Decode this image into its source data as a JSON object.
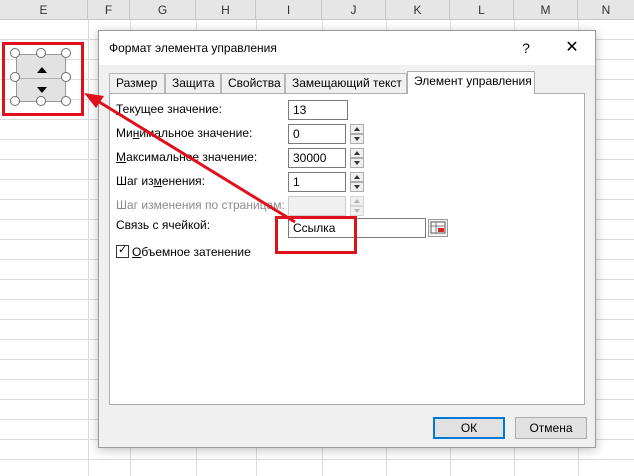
{
  "sheet": {
    "columns": [
      "E",
      "F",
      "G",
      "H",
      "I",
      "J",
      "K",
      "L",
      "M",
      "N"
    ]
  },
  "dialog": {
    "title": "Формат элемента управления",
    "help_glyph": "?",
    "close_glyph": "✕",
    "tabs": [
      {
        "label": "Размер"
      },
      {
        "label": "Защита"
      },
      {
        "label": "Свойства"
      },
      {
        "label": "Замещающий текст"
      },
      {
        "label": "Элемент управления",
        "active": true
      }
    ],
    "fields": {
      "current": {
        "label_pre": "",
        "label_u": "Т",
        "label_post": "екущее значение:",
        "value": "13"
      },
      "min": {
        "label_pre": "Ми",
        "label_u": "н",
        "label_post": "имальное значение:",
        "value": "0"
      },
      "max": {
        "label_pre": "",
        "label_u": "М",
        "label_post": "аксимальное значение:",
        "value": "30000"
      },
      "step": {
        "label_pre": "Шаг из",
        "label_u": "м",
        "label_post": "енения:",
        "value": "1"
      },
      "page_step": {
        "label": "Шаг изменения по страницам:",
        "value": "",
        "disabled": true
      },
      "cell_link": {
        "label": "Связь с ячейкой:",
        "value": "Ссылка"
      }
    },
    "shading": {
      "label_u": "О",
      "label_post": "бъемное затенение",
      "checked": true
    },
    "buttons": {
      "ok": "ОК",
      "cancel": "Отмена"
    }
  },
  "colors": {
    "highlight": "#e0101c",
    "default_button_border": "#0078d7"
  },
  "icons": {
    "spinner_up": "triangle-up-icon",
    "spinner_down": "triangle-down-icon",
    "range_picker": "range-select-icon",
    "checkmark": "✓"
  }
}
